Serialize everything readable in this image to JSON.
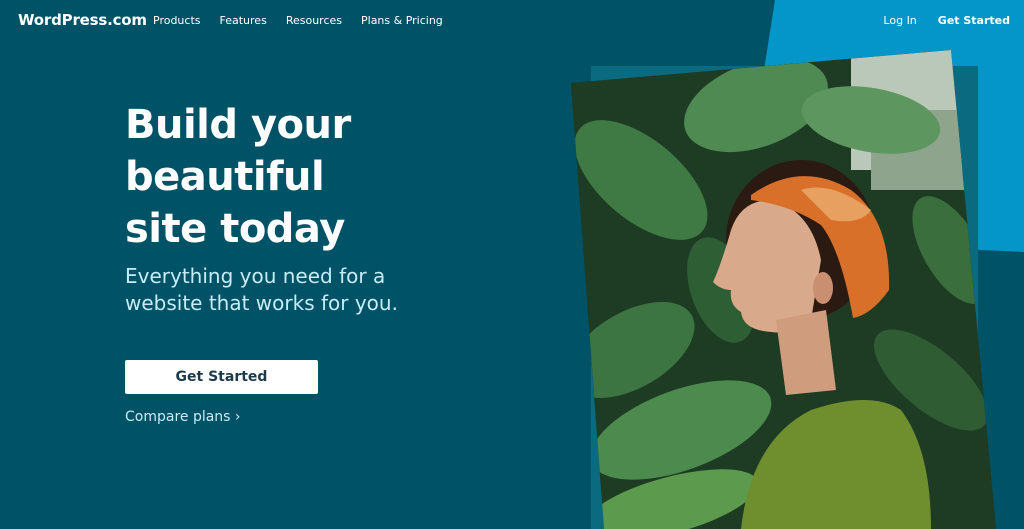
{
  "header": {
    "logo": "WordPress.com",
    "nav": [
      "Products",
      "Features",
      "Resources",
      "Plans & Pricing"
    ],
    "login": "Log In",
    "get_started": "Get Started"
  },
  "hero": {
    "title_lines": [
      "Build your",
      "beautiful",
      "site today"
    ],
    "subtitle": "Everything you need for a website that works for you.",
    "cta": "Get Started",
    "compare": "Compare plans ›"
  },
  "image": {
    "description_icon": "photo-woman-in-plants"
  },
  "colors": {
    "bg": "#005266",
    "accent": "#0596c9",
    "text_light": "#c7ecf6"
  }
}
